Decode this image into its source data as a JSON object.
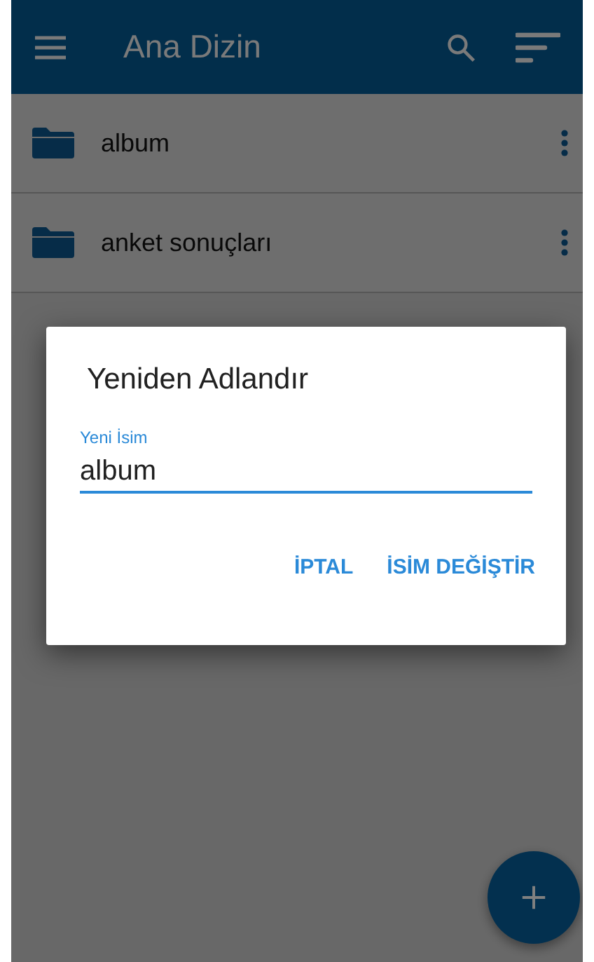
{
  "app_bar": {
    "title": "Ana Dizin"
  },
  "folders": [
    {
      "name": "album"
    },
    {
      "name": "anket sonuçları"
    }
  ],
  "dialog": {
    "title": "Yeniden Adlandır",
    "field": {
      "label": "Yeni İsim",
      "value": "album"
    },
    "buttons": [
      {
        "label": "İPTAL"
      },
      {
        "label": "İSİM DEĞİŞTİR"
      }
    ]
  }
}
